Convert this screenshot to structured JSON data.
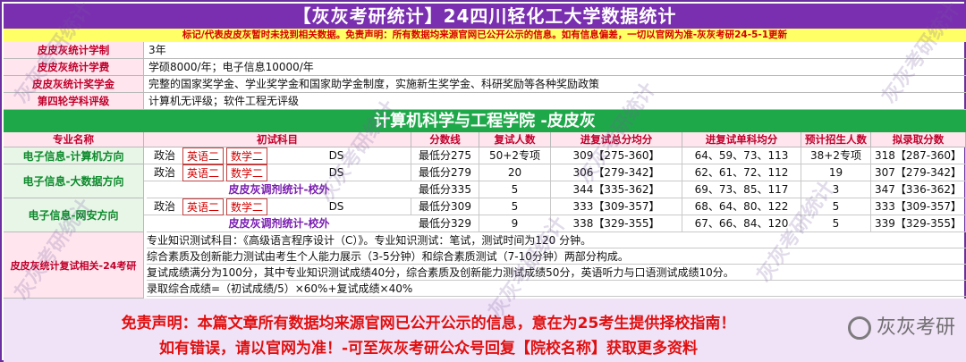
{
  "title": "【灰灰考研统计】24四川轻化工大学数据统计",
  "notice": "标记/代表皮皮灰暂时未找到相关数据。免责声明：所有数据均来源官网已公开公示的信息。如有信息偏差，一切以官网为准-灰灰考研24-5-1更新",
  "info": [
    {
      "label": "皮皮灰统计学制",
      "value": "3年"
    },
    {
      "label": "皮皮灰统计学费",
      "value": "学硕8000/年；电子信息10000/年"
    },
    {
      "label": "皮皮灰统计奖学金",
      "value": "完整的国家奖学金、学业奖学金和国家助学金制度，实施新生奖学金、科研奖励等各种奖励政策"
    },
    {
      "label": "第四轮学科评级",
      "value": "计算机无评级；软件工程无评级"
    }
  ],
  "college": "计算机科学与工程学院 -皮皮灰",
  "headers": [
    "专业名称",
    "初试科目",
    "分数线",
    "复试人数",
    "进复试总分均分",
    "进复试单科均分",
    "预计招生人数",
    "拟录取分数"
  ],
  "majors": [
    "电子信息-计算机方向",
    "电子信息-大数据方向",
    "电子信息-网安方向"
  ],
  "subjects": {
    "politics": "政治",
    "english": "英语二",
    "math": "数学二",
    "prof": "DS"
  },
  "rows": [
    {
      "line": "最低分275",
      "retest": "50+2专项",
      "avg_total": "309【275-360】",
      "avg_single": "64、59、73、113",
      "plan": "38+2专项",
      "admit": "318【287-360】"
    },
    {
      "line": "最低分279",
      "retest": "20",
      "avg_total": "306【279-342】",
      "avg_single": "62、61、72、112",
      "plan": "19",
      "admit": "307【279-342】"
    },
    {
      "line": "最低分335",
      "retest": "5",
      "avg_total": "344【335-362】",
      "avg_single": "69、73、85、117",
      "plan": "3",
      "admit": "347【336-362】"
    },
    {
      "line": "最低分309",
      "retest": "5",
      "avg_total": "333【309-357】",
      "avg_single": "68、64、80、122",
      "plan": "5",
      "admit": "333【309-357】"
    },
    {
      "line": "最低分329",
      "retest": "9",
      "avg_total": "338【329-355】",
      "avg_single": "67、66、84、120",
      "plan": "5",
      "admit": "339【329-355】"
    }
  ],
  "adjust_label": "皮皮灰调剂统计-校外",
  "retest_label": "皮皮灰统计复试相关-24考研",
  "retest_lines": [
    "专业知识测试科目：《高级语言程序设计（C）》。专业知识测试：笔试，测试时间为120 分钟。",
    "综合素质及创新能力测试由考生个人能力展示（3-5分钟）和综合素质测试（7-10分钟）两部分构成。",
    "复试成绩满分为100分，其中专业知识测试成绩40分，综合素质及创新能力测试成绩50分，英语听力与口语测试成绩10分。",
    "录取综合成绩=（初试成绩/5）×60%+复试成绩×40%"
  ],
  "disclaimer_1": "免责声明：本篇文章所有数据均来源官网已公开公示的信息，意在为25考生提供择校指南！",
  "disclaimer_2": "如有错误，请以官网为准！-可至灰灰考研公众号回复【院校名称】获取更多资料",
  "watermark": "灰灰考研统计",
  "brand": "灰灰考研"
}
